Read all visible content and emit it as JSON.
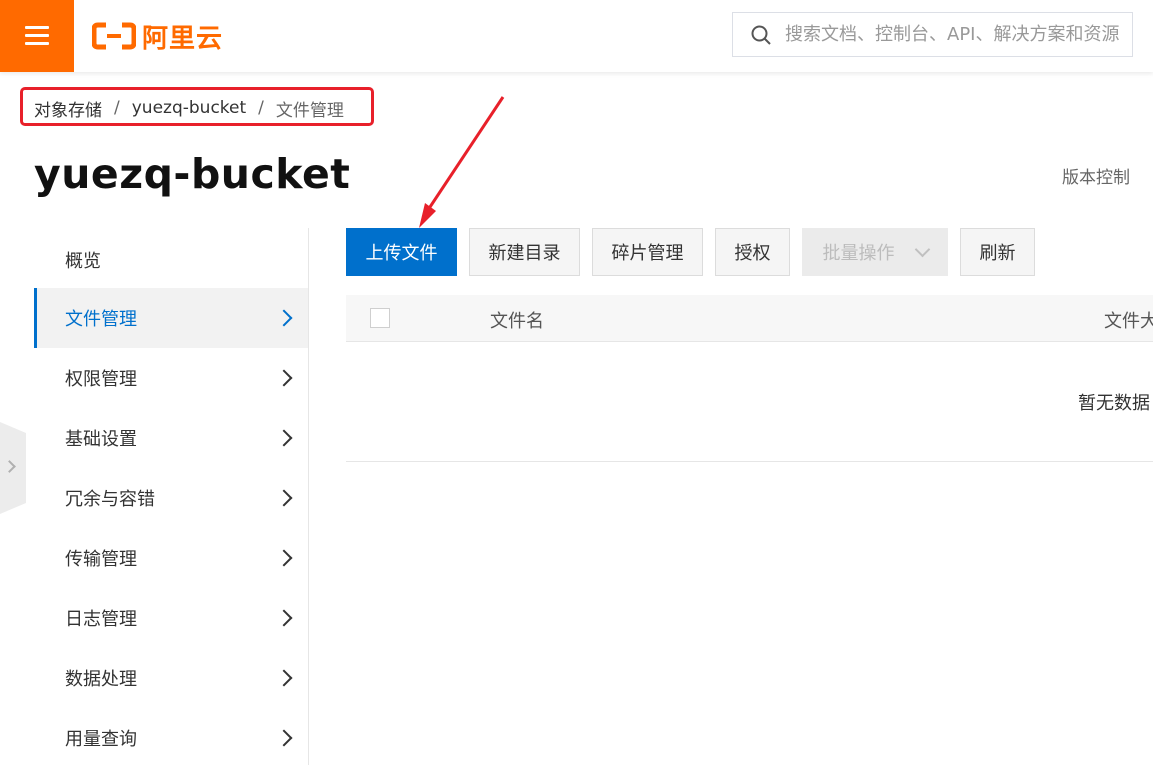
{
  "header": {
    "logo_text": "阿里云",
    "brand_color": "#ff6a00",
    "search_placeholder": "搜索文档、控制台、API、解决方案和资源"
  },
  "breadcrumb": {
    "items": [
      "对象存储",
      "yuezq-bucket",
      "文件管理"
    ],
    "separator": "/"
  },
  "page": {
    "title": "yuezq-bucket",
    "version_control_label": "版本控制"
  },
  "sidebar": {
    "items": [
      {
        "label": "概览",
        "has_chevron": false,
        "active": false
      },
      {
        "label": "文件管理",
        "has_chevron": true,
        "active": true
      },
      {
        "label": "权限管理",
        "has_chevron": true,
        "active": false
      },
      {
        "label": "基础设置",
        "has_chevron": true,
        "active": false
      },
      {
        "label": "冗余与容错",
        "has_chevron": true,
        "active": false
      },
      {
        "label": "传输管理",
        "has_chevron": true,
        "active": false
      },
      {
        "label": "日志管理",
        "has_chevron": true,
        "active": false
      },
      {
        "label": "数据处理",
        "has_chevron": true,
        "active": false
      },
      {
        "label": "用量查询",
        "has_chevron": true,
        "active": false
      }
    ],
    "accent_color": "#0070cc"
  },
  "toolbar": {
    "upload_label": "上传文件",
    "new_dir_label": "新建目录",
    "fragments_label": "碎片管理",
    "authorize_label": "授权",
    "batch_label": "批量操作",
    "refresh_label": "刷新"
  },
  "table": {
    "columns": [
      "文件名",
      "文件大"
    ],
    "empty_text": "暂无数据"
  },
  "annotation": {
    "highlight_color": "#e8202a",
    "icons": [
      "red-highlight-box",
      "red-arrow"
    ]
  }
}
